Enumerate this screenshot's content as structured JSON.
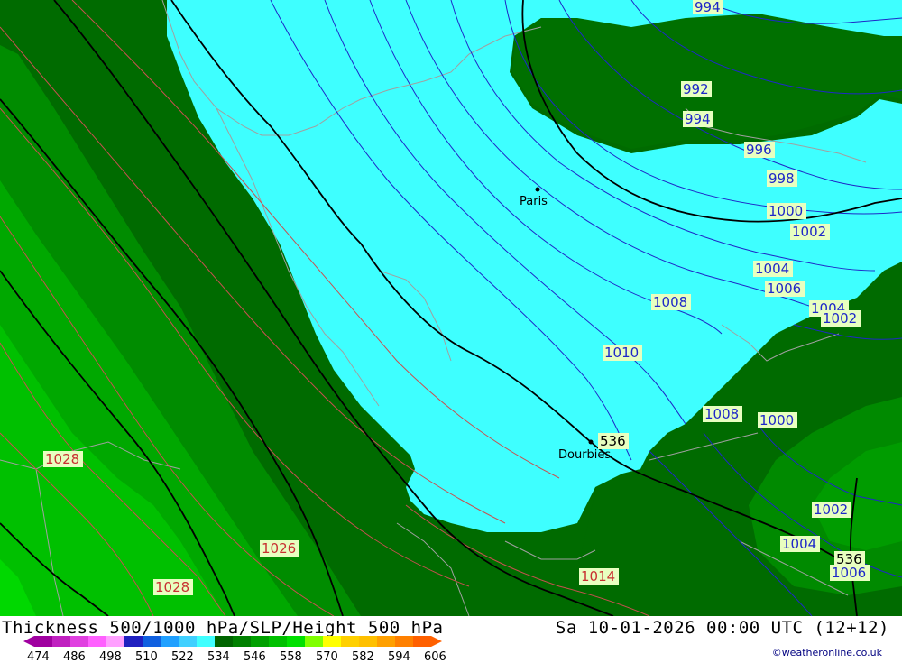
{
  "footer": {
    "title": "Thickness 500/1000 hPa/SLP/Height 500 hPa",
    "datetime": "Sa 10-01-2026 00:00 UTC (12+12)",
    "credit": "©weatheronline.co.uk",
    "legend": {
      "ticks": [
        "474",
        "486",
        "498",
        "510",
        "522",
        "534",
        "546",
        "558",
        "570",
        "582",
        "594",
        "606"
      ],
      "colors": [
        "#a000a0",
        "#c020c0",
        "#e040e0",
        "#ff60ff",
        "#ffa0ff",
        "#2020c0",
        "#1060e0",
        "#20a0ff",
        "#40d0ff",
        "#40ffff",
        "#006400",
        "#008000",
        "#00a000",
        "#00c000",
        "#00e000",
        "#80ff00",
        "#ffff00",
        "#ffd000",
        "#ffc000",
        "#ffa000",
        "#ff8000",
        "#ff6000"
      ]
    }
  },
  "map": {
    "colors": {
      "cyan_zone": "#3effff",
      "dark_green": "#006b00",
      "mid_green": "#008c00",
      "light_green": "#00b400",
      "bright_green": "#00d200",
      "isobar_blue": "#1e28c8",
      "isobar_red": "#c85050",
      "height_line": "#000000",
      "coast": "#a0a0a0"
    },
    "places": [
      {
        "name": "Paris"
      },
      {
        "name": "Dourbies"
      }
    ],
    "isobar_labels": [
      {
        "text": "994",
        "color": "blue"
      },
      {
        "text": "992",
        "color": "blue"
      },
      {
        "text": "994",
        "color": "blue"
      },
      {
        "text": "996",
        "color": "blue"
      },
      {
        "text": "998",
        "color": "blue"
      },
      {
        "text": "1000",
        "color": "blue"
      },
      {
        "text": "1002",
        "color": "blue"
      },
      {
        "text": "1004",
        "color": "blue"
      },
      {
        "text": "1006",
        "color": "blue"
      },
      {
        "text": "1008",
        "color": "blue"
      },
      {
        "text": "1010",
        "color": "blue"
      },
      {
        "text": "1004",
        "color": "blue"
      },
      {
        "text": "1002",
        "color": "blue"
      },
      {
        "text": "1008",
        "color": "blue"
      },
      {
        "text": "1000",
        "color": "blue"
      },
      {
        "text": "1002",
        "color": "blue"
      },
      {
        "text": "1004",
        "color": "blue"
      },
      {
        "text": "1006",
        "color": "blue"
      },
      {
        "text": "1028",
        "color": "red"
      },
      {
        "text": "1026",
        "color": "red"
      },
      {
        "text": "1028",
        "color": "red"
      },
      {
        "text": "1014",
        "color": "red"
      }
    ],
    "height_labels": [
      {
        "text": "536"
      },
      {
        "text": "536"
      }
    ]
  }
}
